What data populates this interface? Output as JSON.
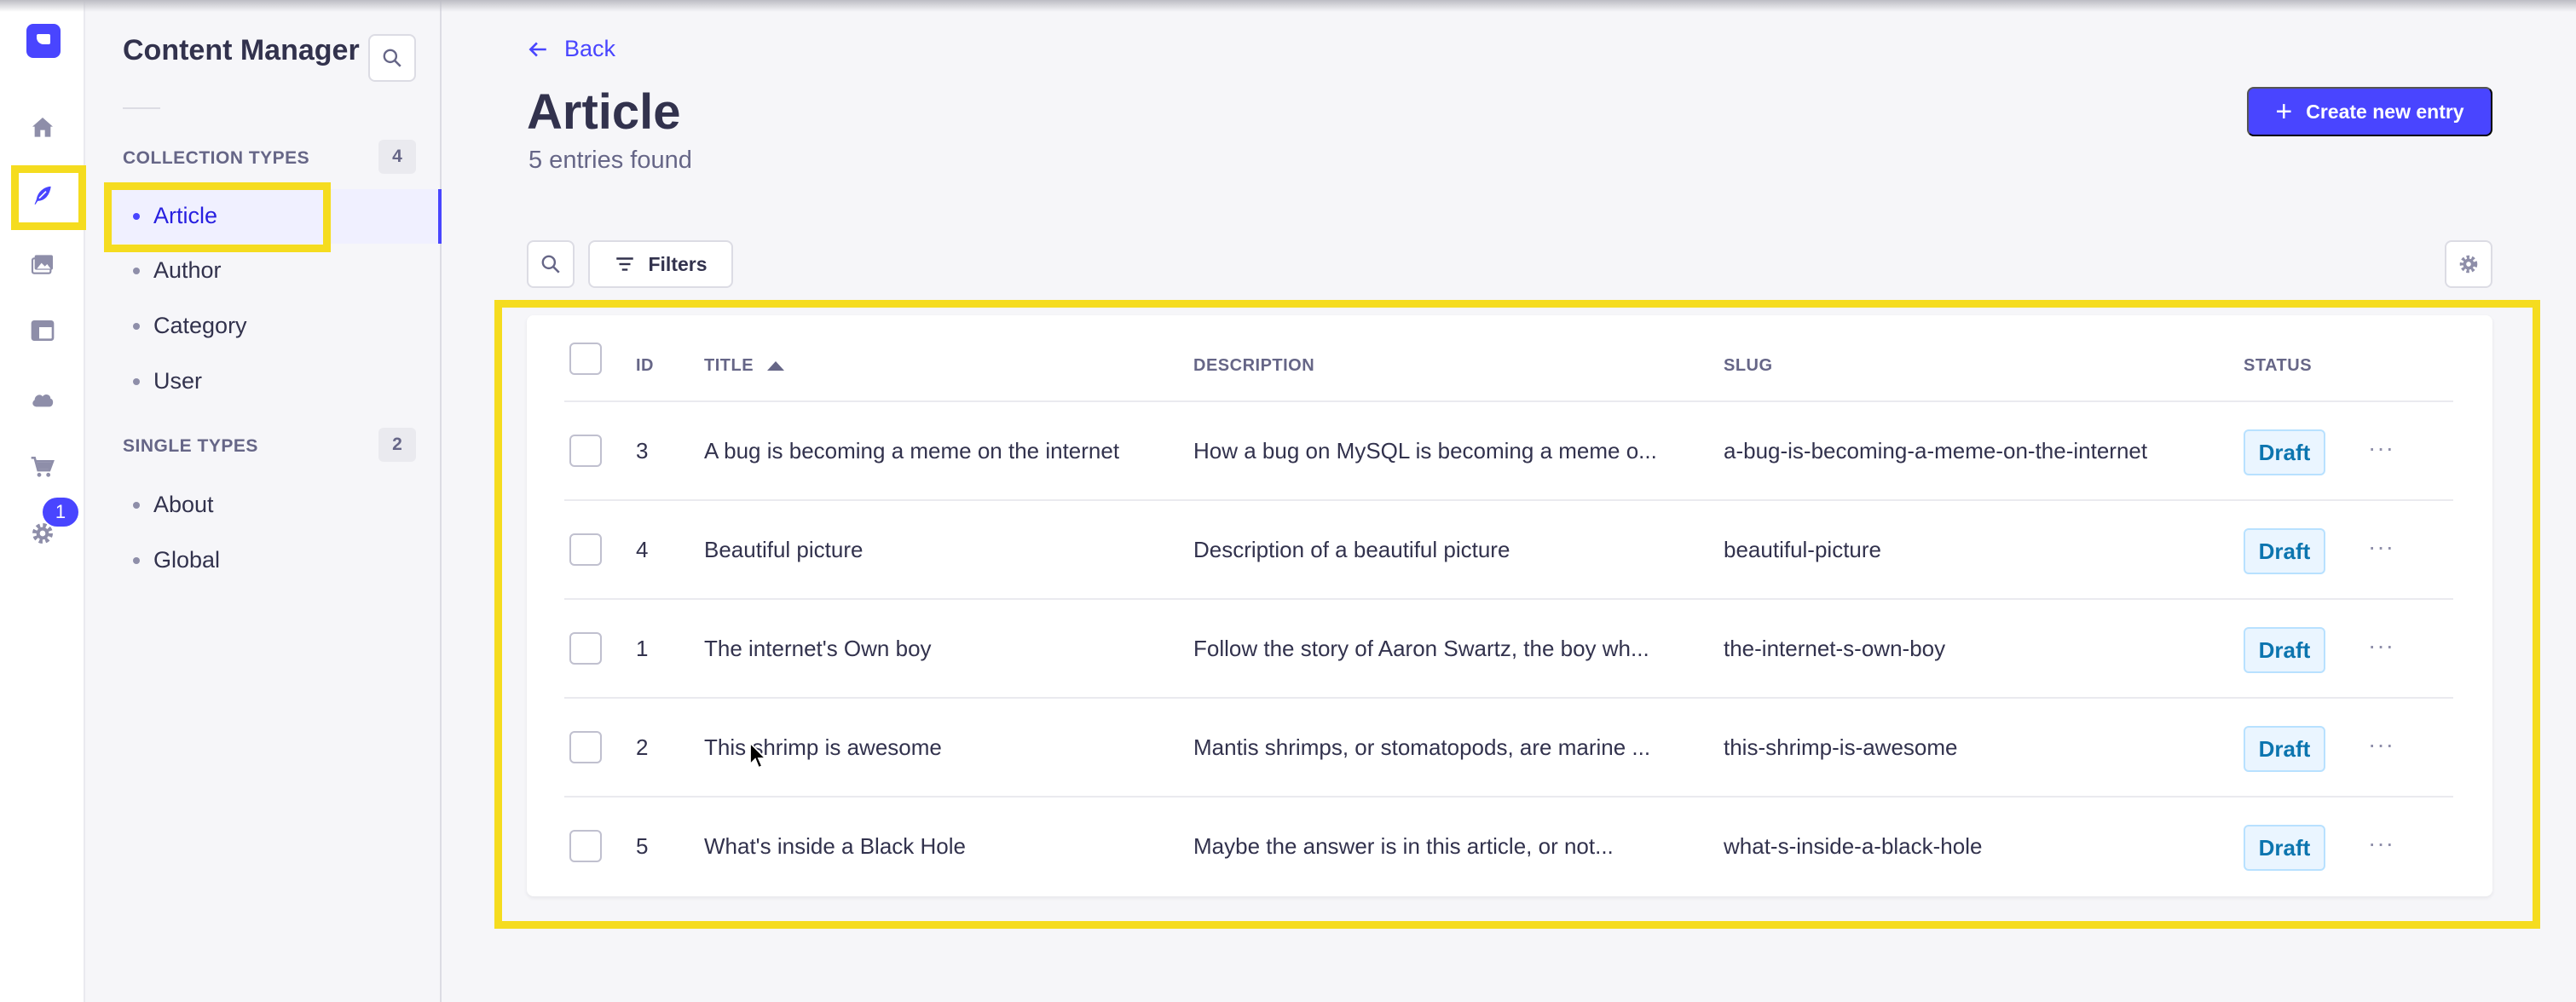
{
  "app": {
    "name": "Content Manager",
    "notification_count": "1"
  },
  "rail": {
    "icons": [
      "logo-icon",
      "home-icon",
      "content-manager-icon",
      "media-library-icon",
      "content-type-builder-icon",
      "cloud-icon",
      "marketplace-icon",
      "settings-icon"
    ]
  },
  "subnav": {
    "title": "Content Manager",
    "collection_types": {
      "label": "COLLECTION TYPES",
      "count": "4",
      "items": [
        {
          "label": "Article",
          "active": true
        },
        {
          "label": "Author",
          "active": false
        },
        {
          "label": "Category",
          "active": false
        },
        {
          "label": "User",
          "active": false
        }
      ]
    },
    "single_types": {
      "label": "SINGLE TYPES",
      "count": "2",
      "items": [
        {
          "label": "About"
        },
        {
          "label": "Global"
        }
      ]
    }
  },
  "header": {
    "back_label": "Back",
    "title": "Article",
    "subtitle": "5 entries found",
    "create_label": "Create new entry"
  },
  "toolbar": {
    "filters_label": "Filters"
  },
  "table": {
    "columns": [
      "ID",
      "TITLE",
      "DESCRIPTION",
      "SLUG",
      "STATUS"
    ],
    "rows": [
      {
        "id": "3",
        "title": "A bug is becoming a meme on the internet",
        "description": "How a bug on MySQL is becoming a meme o...",
        "slug": "a-bug-is-becoming-a-meme-on-the-internet",
        "status": "Draft"
      },
      {
        "id": "4",
        "title": "Beautiful picture",
        "description": "Description of a beautiful picture",
        "slug": "beautiful-picture",
        "status": "Draft"
      },
      {
        "id": "1",
        "title": "The internet's Own boy",
        "description": "Follow the story of Aaron Swartz, the boy wh...",
        "slug": "the-internet-s-own-boy",
        "status": "Draft"
      },
      {
        "id": "2",
        "title": "This shrimp is awesome",
        "description": "Mantis shrimps, or stomatopods, are marine ...",
        "slug": "this-shrimp-is-awesome",
        "status": "Draft"
      },
      {
        "id": "5",
        "title": "What's inside a Black Hole",
        "description": "Maybe the answer is in this article, or not...",
        "slug": "what-s-inside-a-black-hole",
        "status": "Draft"
      }
    ],
    "more_label": "···"
  },
  "colors": {
    "primary": "#4945ff",
    "highlight": "#f5dc1f",
    "draft_text": "#0c75af",
    "draft_bg": "#eaf5ff"
  }
}
